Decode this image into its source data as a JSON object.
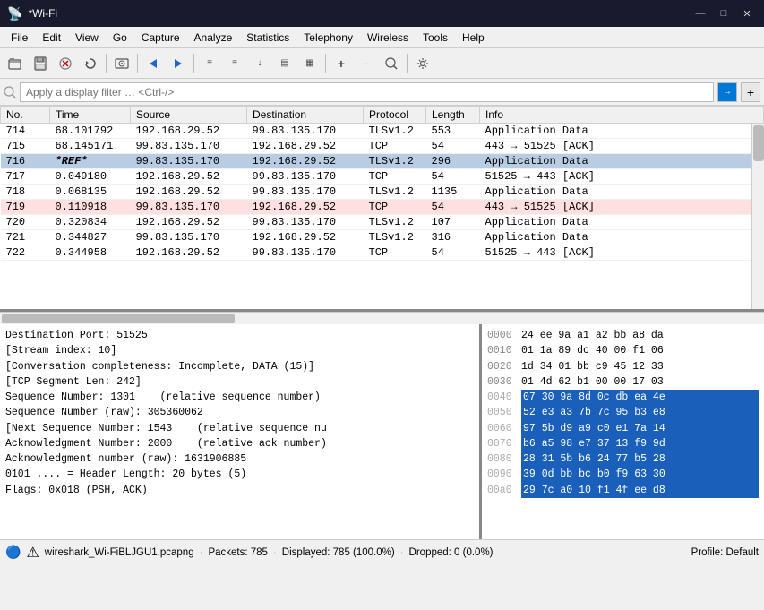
{
  "titlebar": {
    "title": "*Wi-Fi",
    "icon": "📡",
    "buttons": {
      "minimize": "—",
      "maximize": "□",
      "close": "✕"
    }
  },
  "menubar": {
    "items": [
      "File",
      "Edit",
      "View",
      "Go",
      "Capture",
      "Analyze",
      "Statistics",
      "Telephony",
      "Wireless",
      "Tools",
      "Help"
    ]
  },
  "toolbar": {
    "buttons": [
      "📁",
      "💾",
      "✕",
      "⟳",
      "📦",
      "◀",
      "▶",
      "📋",
      "📋",
      "📥",
      "📤",
      "🔍",
      "➕",
      "➖",
      "🔎",
      "⚙"
    ]
  },
  "filterbar": {
    "placeholder": "Apply a display filter … <Ctrl-/>",
    "arrow_label": "→",
    "plus_label": "+"
  },
  "packet_table": {
    "columns": [
      "No.",
      "Time",
      "Source",
      "Destination",
      "Protocol",
      "Length",
      "Info"
    ],
    "rows": [
      {
        "no": "714",
        "time": "68.101792",
        "src": "192.168.29.52",
        "dst": "99.83.135.170",
        "proto": "TLSv1.2",
        "len": "553",
        "info": "Application Data",
        "style": "normal"
      },
      {
        "no": "715",
        "time": "68.145171",
        "src": "99.83.135.170",
        "dst": "192.168.29.52",
        "proto": "TCP",
        "len": "54",
        "info": "443 → 51525 [ACK]",
        "style": "normal"
      },
      {
        "no": "716",
        "time": "*REF*",
        "src": "99.83.135.170",
        "dst": "192.168.29.52",
        "proto": "TLSv1.2",
        "len": "296",
        "info": "Application Data",
        "style": "selected"
      },
      {
        "no": "717",
        "time": "0.049180",
        "src": "192.168.29.52",
        "dst": "99.83.135.170",
        "proto": "TCP",
        "len": "54",
        "info": "51525 → 443 [ACK]",
        "style": "normal"
      },
      {
        "no": "718",
        "time": "0.068135",
        "src": "192.168.29.52",
        "dst": "99.83.135.170",
        "proto": "TLSv1.2",
        "len": "1135",
        "info": "Application Data",
        "style": "normal"
      },
      {
        "no": "719",
        "time": "0.110918",
        "src": "99.83.135.170",
        "dst": "192.168.29.52",
        "proto": "TCP",
        "len": "54",
        "info": "443 → 51525 [ACK]",
        "style": "error"
      },
      {
        "no": "720",
        "time": "0.320834",
        "src": "192.168.29.52",
        "dst": "99.83.135.170",
        "proto": "TLSv1.2",
        "len": "107",
        "info": "Application Data",
        "style": "normal"
      },
      {
        "no": "721",
        "time": "0.344827",
        "src": "99.83.135.170",
        "dst": "192.168.29.52",
        "proto": "TLSv1.2",
        "len": "316",
        "info": "Application Data",
        "style": "normal"
      },
      {
        "no": "722",
        "time": "0.344958",
        "src": "192.168.29.52",
        "dst": "99.83.135.170",
        "proto": "TCP",
        "len": "54",
        "info": "51525 → 443 [ACK]",
        "style": "normal"
      }
    ]
  },
  "detail_panel": {
    "lines": [
      "Destination Port: 51525",
      "[Stream index: 10]",
      "[Conversation completeness: Incomplete, DATA (15)]",
      "[TCP Segment Len: 242]",
      "Sequence Number: 1301    (relative sequence number)",
      "Sequence Number (raw): 305360062",
      "[Next Sequence Number: 1543    (relative sequence nu",
      "Acknowledgment Number: 2000    (relative ack number)",
      "Acknowledgment number (raw): 1631906885",
      "0101 .... = Header Length: 20 bytes (5)",
      "Flags: 0x018 (PSH, ACK)"
    ]
  },
  "hex_panel": {
    "rows": [
      {
        "offset": "0000",
        "bytes": "24 ee 9a a1 a2 bb a8 da",
        "highlight": false
      },
      {
        "offset": "0010",
        "bytes": "01 1a 89 dc 40 00 f1 06",
        "highlight": false
      },
      {
        "offset": "0020",
        "bytes": "1d 34 01 bb c9 45 12 33",
        "highlight": false
      },
      {
        "offset": "0030",
        "bytes": "01 4d 62 b1 00 00 17 03",
        "highlight": false
      },
      {
        "offset": "0040",
        "bytes": "07 30 9a 8d 0c db ea 4e",
        "highlight": true
      },
      {
        "offset": "0050",
        "bytes": "52 e3 a3 7b 7c 95 b3 e8",
        "highlight": true
      },
      {
        "offset": "0060",
        "bytes": "97 5b d9 a9 c0 e1 7a 14",
        "highlight": true
      },
      {
        "offset": "0070",
        "bytes": "b6 a5 98 e7 37 13 f9 9d",
        "highlight": true
      },
      {
        "offset": "0080",
        "bytes": "28 31 5b b6 24 77 b5 28",
        "highlight": true
      },
      {
        "offset": "0090",
        "bytes": "39 0d bb bc b0 f9 63 30",
        "highlight": true
      },
      {
        "offset": "00a0",
        "bytes": "29 7c a0 10 f1 4f ee d8",
        "highlight": true
      }
    ]
  },
  "statusbar": {
    "icon": "🔵",
    "file": "wireshark_Wi-FiBLJGU1.pcapng",
    "packets_label": "Packets: 785",
    "displayed_label": "Displayed: 785 (100.0%)",
    "dropped_label": "Dropped: 0 (0.0%)",
    "profile_label": "Profile: Default"
  }
}
